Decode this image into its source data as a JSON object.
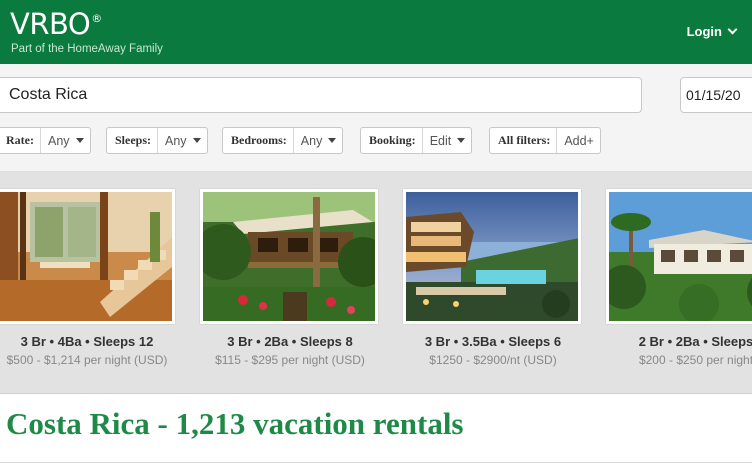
{
  "header": {
    "logo_text": "VRBO",
    "logo_mark": "®",
    "tagline": "Part of the HomeAway Family",
    "login_label": "Login",
    "brand_color": "#0b7a3e"
  },
  "search": {
    "location_value": "Costa Rica",
    "date_value": "01/15/20"
  },
  "filters": [
    {
      "label": "Rate:",
      "value": "Any"
    },
    {
      "label": "Sleeps:",
      "value": "Any"
    },
    {
      "label": "Bedrooms:",
      "value": "Any"
    },
    {
      "label": "Booking:",
      "value": "Edit"
    },
    {
      "label": "All filters:",
      "value": "Add+"
    }
  ],
  "listings": [
    {
      "specs": "3 Br • 4Ba • Sleeps 12",
      "price": "$500 - $1,214 per night (USD)"
    },
    {
      "specs": "3 Br • 2Ba • Sleeps 8",
      "price": "$115 - $295 per night (USD)"
    },
    {
      "specs": "3 Br • 3.5Ba • Sleeps 6",
      "price": "$1250 - $2900/nt (USD)"
    },
    {
      "specs": "2 Br • 2Ba • Sleeps",
      "price": "$200 - $250 per night"
    }
  ],
  "results": {
    "title": "Costa Rica - 1,213 vacation rentals",
    "title_color": "#1f8a47"
  }
}
